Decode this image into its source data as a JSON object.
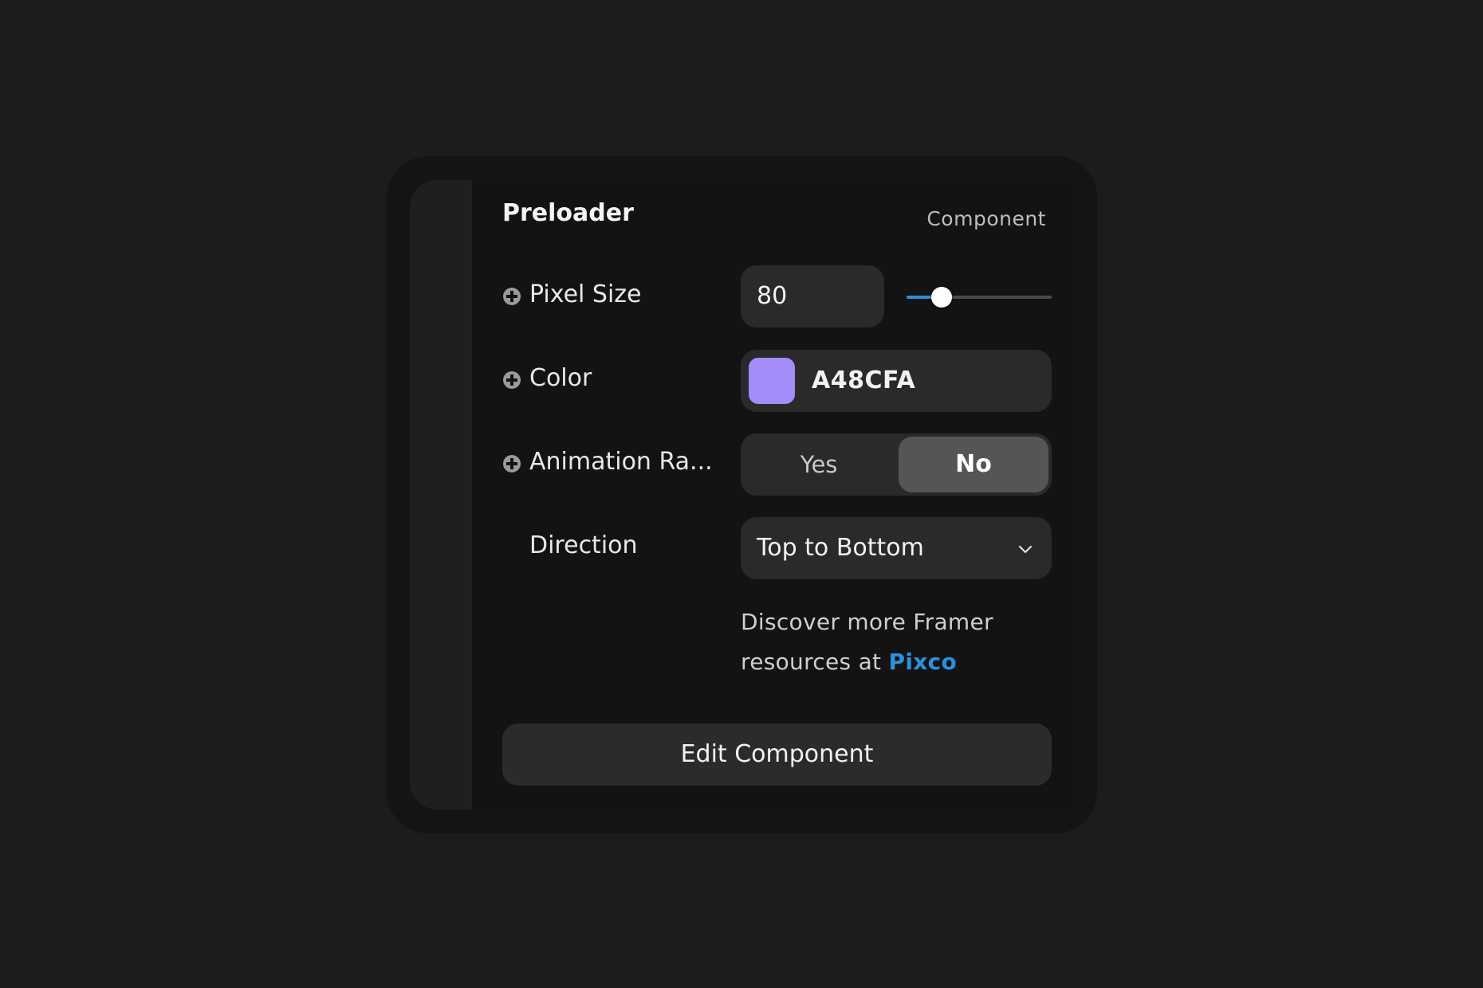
{
  "panel": {
    "title": "Preloader",
    "type_label": "Component"
  },
  "properties": {
    "pixel_size": {
      "label": "Pixel Size",
      "value": "80",
      "slider_fraction": 0.24,
      "icon": "plus-circle-icon"
    },
    "color": {
      "label": "Color",
      "hex": "A48CFA",
      "swatch_color": "#A48CFA",
      "icon": "plus-circle-icon"
    },
    "animation": {
      "label": "Animation Ra...",
      "options": [
        "Yes",
        "No"
      ],
      "selected": "No",
      "icon": "plus-circle-icon"
    },
    "direction": {
      "label": "Direction",
      "value": "Top to Bottom",
      "icon": "chevron-down-icon"
    }
  },
  "footer": {
    "discover_text": "Discover more Framer resources at ",
    "link_text": "Pixco",
    "link_color": "#2C90DC",
    "edit_button_label": "Edit Component"
  },
  "colors": {
    "accent": "#2A8FDC",
    "background": "#1C1C1C",
    "panel": "#131313",
    "field": "#2A2A2A"
  }
}
